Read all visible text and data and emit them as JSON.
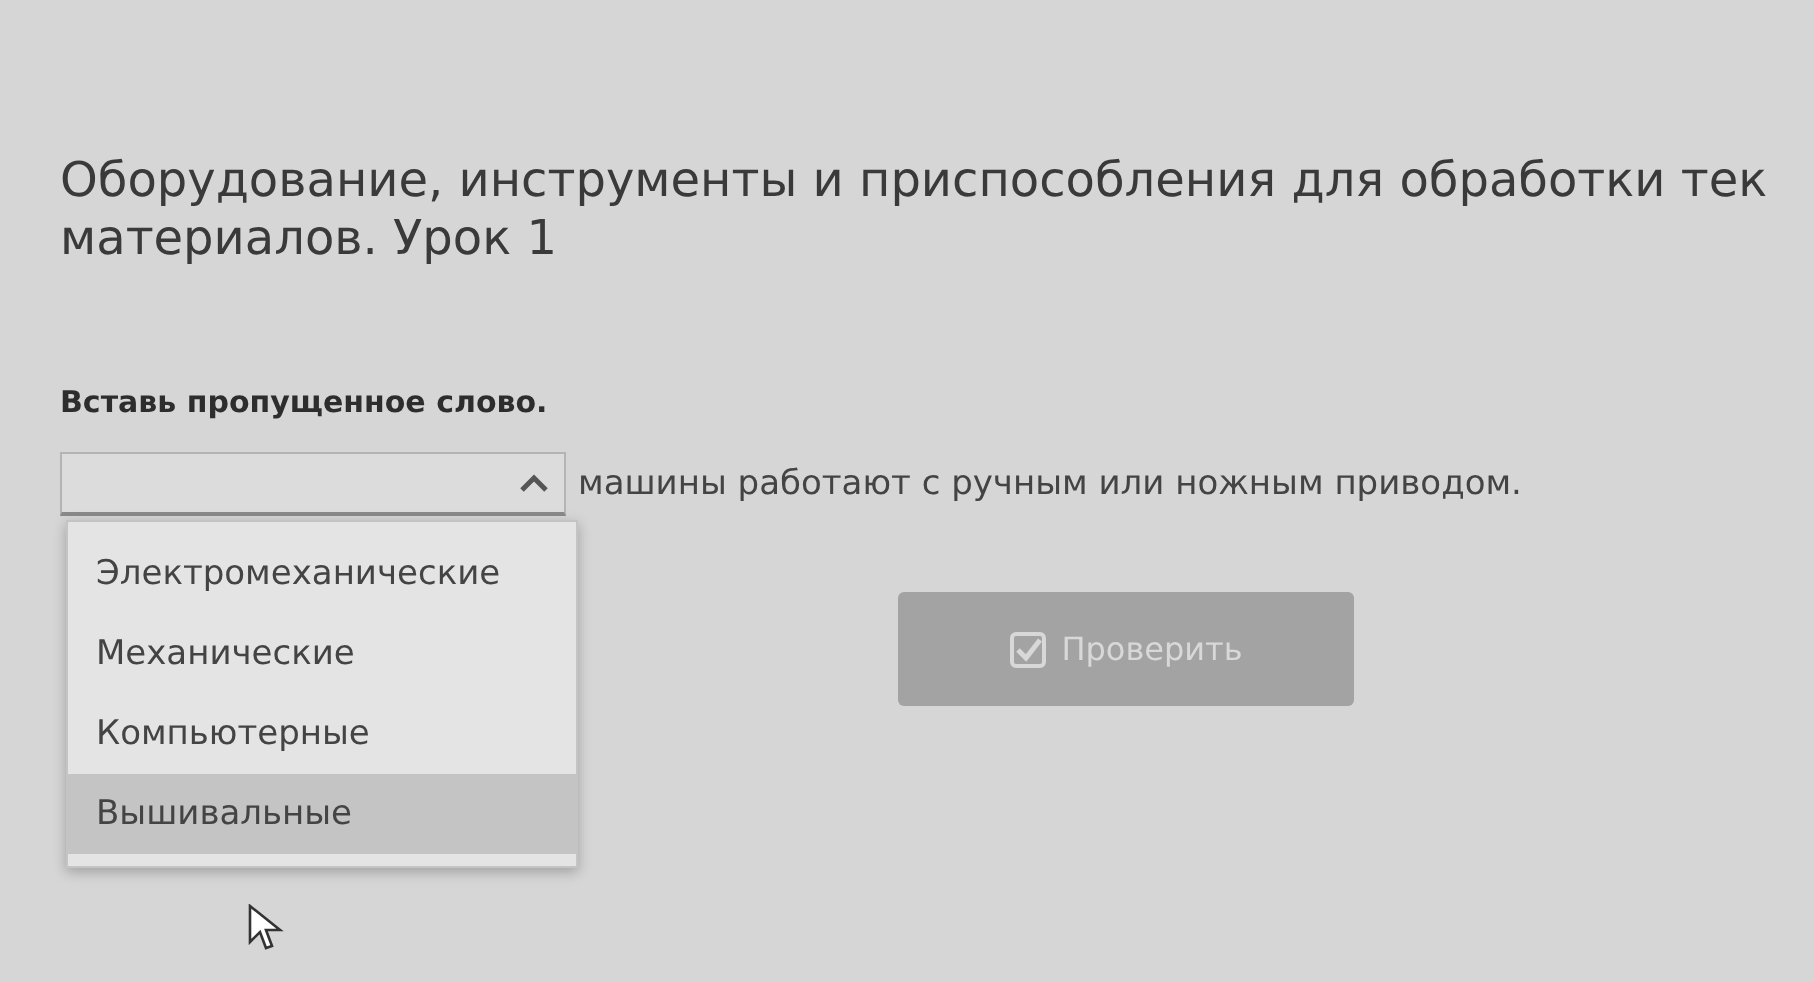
{
  "title_lines": [
    "Оборудование, инструменты и приспособления для обработки тек",
    "материалов. Урок 1"
  ],
  "instruction": "Вставь пропущенное слово.",
  "select": {
    "expanded": true
  },
  "sentence_rest": "машины работают с ручным или ножным приводом.",
  "options": [
    {
      "label": "Электромеханические",
      "highlighted": false
    },
    {
      "label": "Механические",
      "highlighted": false
    },
    {
      "label": "Компьютерные",
      "highlighted": false
    },
    {
      "label": "Вышивальные",
      "highlighted": true
    }
  ],
  "check_button": {
    "label": "Проверить",
    "disabled": true
  }
}
